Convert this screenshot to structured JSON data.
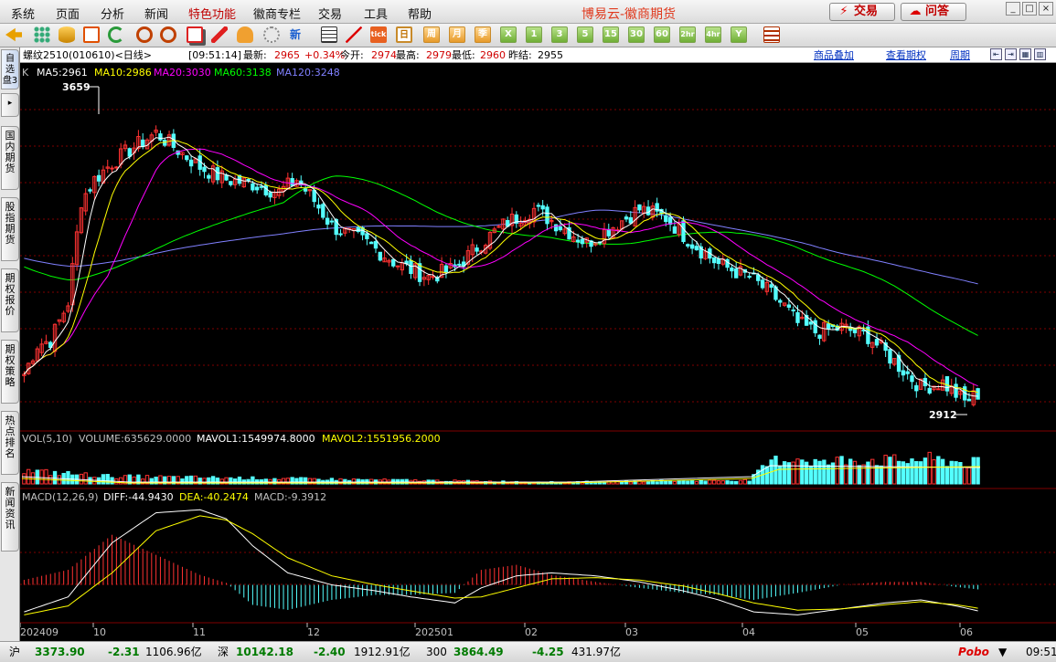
{
  "menu": [
    "系统",
    "页面",
    "分析",
    "新闻",
    "特色功能",
    "徽商专栏",
    "交易",
    "工具",
    "帮助"
  ],
  "menu_highlight": "特色功能",
  "app_title": "博易云-徽商期货",
  "buttons": {
    "trade": "交易",
    "ask": "问答"
  },
  "toolbar": {
    "periods": [
      "日",
      "周",
      "月",
      "季",
      "X",
      "1",
      "3",
      "5",
      "15",
      "30",
      "60",
      "2hr",
      "4hr",
      "Y"
    ],
    "selected_period": "日"
  },
  "left_tabs": [
    "自选盘3",
    "国内期货",
    "股指期货",
    "期权报价",
    "期权策略",
    "热点排名",
    "新闻资讯"
  ],
  "info": {
    "contract": "螺纹2510(010610)<日线>",
    "time": "[09:51:14]",
    "latest_label": "最新:",
    "latest": "2965",
    "change": "+0.34%",
    "open_label": "今开:",
    "open": "2974",
    "high_label": "最高:",
    "high": "2979",
    "low_label": "最低:",
    "low": "2960",
    "prev_label": "昨结:",
    "prev": "2955",
    "links": [
      "商品叠加",
      "查看期权",
      "周期"
    ]
  },
  "indicators": {
    "k": "K",
    "ma": [
      {
        "label": "MA5:2961",
        "color": "#ffffff"
      },
      {
        "label": "MA10:2986",
        "color": "#ffff00"
      },
      {
        "label": "MA20:3030",
        "color": "#ff00ff"
      },
      {
        "label": "MA60:3138",
        "color": "#00ff00"
      },
      {
        "label": "MA120:3248",
        "color": "#8080ff"
      }
    ],
    "vol": [
      {
        "label": "VOL(5,10)",
        "color": "#c0c0c0"
      },
      {
        "label": "VOLUME:635629.0000",
        "color": "#c0c0c0"
      },
      {
        "label": "MAVOL1:1549974.8000",
        "color": "#ffffff"
      },
      {
        "label": "MAVOL2:1551956.2000",
        "color": "#ffff00"
      }
    ],
    "macd": [
      {
        "label": "MACD(12,26,9)",
        "color": "#c0c0c0"
      },
      {
        "label": "DIFF:-44.9430",
        "color": "#ffffff"
      },
      {
        "label": "DEA:-40.2474",
        "color": "#ffff00"
      },
      {
        "label": "MACD:-9.3912",
        "color": "#c0c0c0"
      }
    ]
  },
  "markers": {
    "high": "3659",
    "low": "2912"
  },
  "x_axis": [
    "202409",
    "10",
    "11",
    "12",
    "202501",
    "02",
    "03",
    "04",
    "05",
    "06"
  ],
  "colors": {
    "up": "#ff3232",
    "down": "#54ffff",
    "ma5": "#ffffff",
    "ma10": "#ffff00",
    "ma20": "#ff00ff",
    "ma60": "#00ff00",
    "ma120": "#8080ff",
    "grid": "#800000"
  },
  "chart_data": {
    "type": "candlestick",
    "x_labels": [
      "202409",
      "10",
      "11",
      "12",
      "202501",
      "02",
      "03",
      "04",
      "05",
      "06"
    ],
    "y_range": [
      2880,
      3700
    ],
    "price_path": [
      [
        0,
        3010
      ],
      [
        3,
        3080
      ],
      [
        6,
        3090
      ],
      [
        10,
        3180
      ],
      [
        13,
        3420
      ],
      [
        16,
        3470
      ],
      [
        20,
        3510
      ],
      [
        24,
        3540
      ],
      [
        30,
        3580
      ],
      [
        35,
        3540
      ],
      [
        40,
        3500
      ],
      [
        46,
        3470
      ],
      [
        52,
        3460
      ],
      [
        58,
        3440
      ],
      [
        62,
        3470
      ],
      [
        66,
        3420
      ],
      [
        70,
        3360
      ],
      [
        78,
        3320
      ],
      [
        85,
        3270
      ],
      [
        92,
        3240
      ],
      [
        98,
        3260
      ],
      [
        104,
        3320
      ],
      [
        110,
        3370
      ],
      [
        116,
        3400
      ],
      [
        122,
        3360
      ],
      [
        128,
        3320
      ],
      [
        134,
        3360
      ],
      [
        140,
        3400
      ],
      [
        146,
        3380
      ],
      [
        152,
        3320
      ],
      [
        158,
        3270
      ],
      [
        165,
        3240
      ],
      [
        170,
        3200
      ],
      [
        173,
        3170
      ],
      [
        176,
        3130
      ],
      [
        180,
        3110
      ],
      [
        186,
        3120
      ],
      [
        192,
        3100
      ],
      [
        196,
        3060
      ],
      [
        199,
        3030
      ],
      [
        204,
        2980
      ],
      [
        209,
        2990
      ],
      [
        214,
        2945
      ],
      [
        218,
        2970
      ]
    ],
    "volume_path": [
      [
        0,
        0.35
      ],
      [
        20,
        0.2
      ],
      [
        120,
        0.05
      ],
      [
        165,
        0.1
      ],
      [
        170,
        0.6
      ],
      [
        176,
        0.72
      ],
      [
        182,
        0.55
      ],
      [
        188,
        0.68
      ],
      [
        198,
        0.62
      ],
      [
        205,
        0.68
      ],
      [
        212,
        0.6
      ],
      [
        218,
        0.55
      ]
    ],
    "macd_diff_path": [
      [
        0,
        -45
      ],
      [
        10,
        -20
      ],
      [
        20,
        70
      ],
      [
        30,
        120
      ],
      [
        40,
        125
      ],
      [
        46,
        110
      ],
      [
        52,
        65
      ],
      [
        60,
        20
      ],
      [
        70,
        0
      ],
      [
        80,
        -10
      ],
      [
        88,
        -20
      ],
      [
        98,
        -30
      ],
      [
        104,
        -5
      ],
      [
        112,
        15
      ],
      [
        120,
        20
      ],
      [
        130,
        15
      ],
      [
        140,
        5
      ],
      [
        150,
        -10
      ],
      [
        158,
        -25
      ],
      [
        166,
        -45
      ],
      [
        176,
        -50
      ],
      [
        186,
        -40
      ],
      [
        196,
        -30
      ],
      [
        204,
        -25
      ],
      [
        212,
        -35
      ],
      [
        218,
        -45
      ]
    ],
    "macd_dea_path": [
      [
        0,
        -50
      ],
      [
        10,
        -35
      ],
      [
        20,
        20
      ],
      [
        30,
        90
      ],
      [
        40,
        115
      ],
      [
        46,
        108
      ],
      [
        52,
        85
      ],
      [
        60,
        45
      ],
      [
        70,
        15
      ],
      [
        80,
        0
      ],
      [
        88,
        -10
      ],
      [
        98,
        -22
      ],
      [
        104,
        -20
      ],
      [
        112,
        -5
      ],
      [
        120,
        10
      ],
      [
        130,
        12
      ],
      [
        140,
        8
      ],
      [
        150,
        -2
      ],
      [
        158,
        -15
      ],
      [
        166,
        -30
      ],
      [
        176,
        -42
      ],
      [
        186,
        -40
      ],
      [
        196,
        -33
      ],
      [
        204,
        -28
      ],
      [
        212,
        -33
      ],
      [
        218,
        -40
      ]
    ],
    "macd_range": [
      -60,
      130
    ],
    "series_count": 218
  }
}
